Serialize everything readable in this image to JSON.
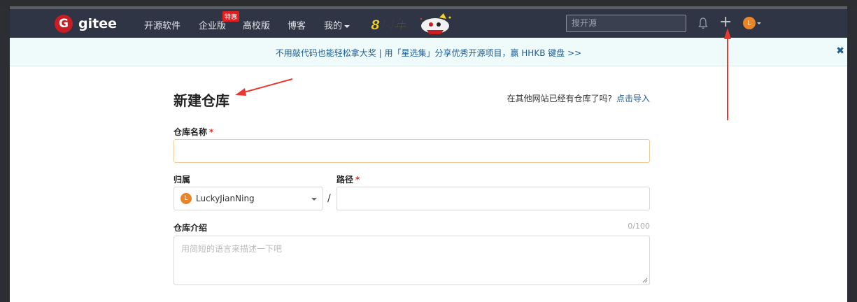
{
  "brand": {
    "logo_letter": "G",
    "name": "gitee"
  },
  "nav": {
    "items": [
      {
        "label": "开源软件"
      },
      {
        "label": "企业版",
        "badge": "特惠"
      },
      {
        "label": "高校版"
      },
      {
        "label": "博客"
      },
      {
        "label": "我的"
      }
    ],
    "anniversary": "8周年",
    "search_placeholder": "搜开源",
    "avatar_letter": "L"
  },
  "banner": {
    "text": "不用敲代码也能轻松拿大奖 | 用「星选集」分享优秀开源项目，赢 HHKB 键盘 >>",
    "close": "✖"
  },
  "form": {
    "title": "新建仓库",
    "import_question": "在其他网站已经有仓库了吗?",
    "import_link": "点击导入",
    "repo_name_label": "仓库名称",
    "required_mark": "*",
    "repo_name_value": "",
    "owner_label": "归属",
    "owner_value": "LuckyJianNing",
    "owner_avatar_letter": "L",
    "path_separator": "/",
    "path_label": "路径",
    "path_value": "",
    "description_label": "仓库介绍",
    "description_counter": "0/100",
    "description_placeholder": "用简短的语言来描述一下吧"
  },
  "colors": {
    "navbar": "#2f3544",
    "brand_red": "#c71d23",
    "banner_bg": "#effbfb",
    "link": "#1d5d94",
    "annotation_red": "#e8382f",
    "avatar": "#e8852b"
  }
}
